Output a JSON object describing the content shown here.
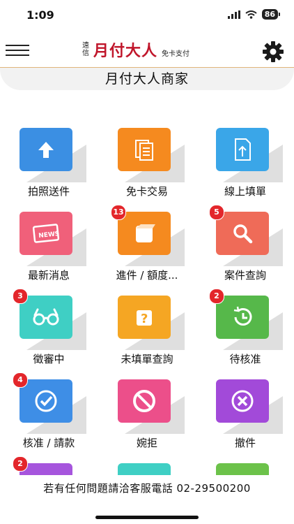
{
  "status": {
    "time": "1:09",
    "battery": "86"
  },
  "header": {
    "logo_small": "遠信",
    "logo_main": "月付大人",
    "logo_tag": "免卡支付"
  },
  "title": "月付大人商家",
  "tiles": [
    {
      "label": "拍照送件",
      "badge": "",
      "color": "#3b8fe3",
      "icon": "upload-arrow-icon"
    },
    {
      "label": "免卡交易",
      "badge": "",
      "color": "#f58a1f",
      "icon": "documents-icon"
    },
    {
      "label": "線上填單",
      "badge": "",
      "color": "#3aa6e8",
      "icon": "file-upload-icon"
    },
    {
      "label": "最新消息",
      "badge": "",
      "color": "#f0607a",
      "icon": "news-icon"
    },
    {
      "label": "進件 / 額度...",
      "badge": "13",
      "color": "#f58a1f",
      "icon": "cube-icon"
    },
    {
      "label": "案件查詢",
      "badge": "5",
      "color": "#ef6b58",
      "icon": "search-icon"
    },
    {
      "label": "徵審中",
      "badge": "3",
      "color": "#3fcfc4",
      "icon": "glasses-icon"
    },
    {
      "label": "未填單查詢",
      "badge": "",
      "color": "#f5a623",
      "icon": "question-box-icon"
    },
    {
      "label": "待核准",
      "badge": "2",
      "color": "#56b84a",
      "icon": "clock-icon"
    },
    {
      "label": "核准 / 請款",
      "badge": "4",
      "color": "#3e8ee6",
      "icon": "check-circle-icon"
    },
    {
      "label": "婉拒",
      "badge": "",
      "color": "#ec4f8a",
      "icon": "forbidden-icon"
    },
    {
      "label": "撤件",
      "badge": "",
      "color": "#a24ad9",
      "icon": "cancel-circle-icon"
    },
    {
      "label": "",
      "badge": "2",
      "color": "#a655dd",
      "icon": ""
    },
    {
      "label": "",
      "badge": "",
      "color": "#3fcfc4",
      "icon": ""
    },
    {
      "label": "",
      "badge": "",
      "color": "#6cc24a",
      "icon": ""
    }
  ],
  "footer": {
    "text": "若有任何問題請洽客服電話 02-29500200"
  }
}
